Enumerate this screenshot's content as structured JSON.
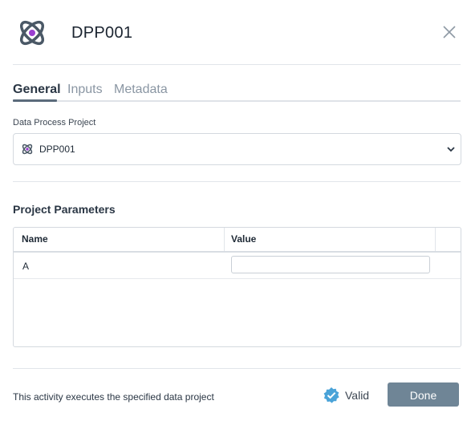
{
  "header": {
    "title": "DPP001",
    "app_icon": "atom-icon",
    "close_icon": "close-icon"
  },
  "tabs": [
    {
      "label": "General",
      "active": true
    },
    {
      "label": "Inputs",
      "active": false
    },
    {
      "label": "Metadata",
      "active": false
    }
  ],
  "field": {
    "label": "Data Process Project",
    "selected_value": "DPP001",
    "value_icon": "atom-icon",
    "dropdown_icon": "chevron-down-icon"
  },
  "parameters": {
    "title": "Project Parameters",
    "columns": [
      "Name",
      "Value"
    ],
    "rows": [
      {
        "name": "A",
        "value": ""
      }
    ]
  },
  "footer": {
    "description": "This activity executes the specified data project",
    "status_label": "Valid",
    "status_icon": "check-badge-icon",
    "done_label": "Done"
  },
  "colors": {
    "accent": "#9b3fd1",
    "icon_stroke": "#4a5866",
    "valid_badge": "#4aa3d8",
    "done_button": "#6f8596"
  }
}
